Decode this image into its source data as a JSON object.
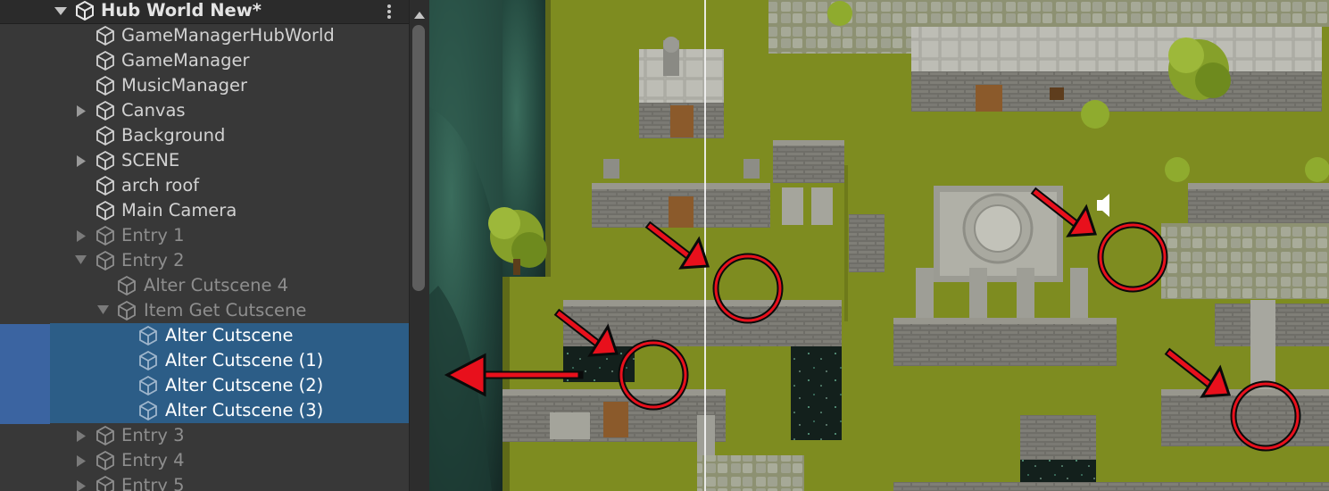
{
  "hierarchy": {
    "scene_name": "Hub World New*",
    "items": [
      {
        "label": "GameManagerHubWorld"
      },
      {
        "label": "GameManager"
      },
      {
        "label": "MusicManager"
      },
      {
        "label": "Canvas"
      },
      {
        "label": "Background"
      },
      {
        "label": "SCENE"
      },
      {
        "label": "arch roof"
      },
      {
        "label": "Main Camera"
      },
      {
        "label": "Entry 1"
      },
      {
        "label": "Entry 2"
      },
      {
        "label": "Alter Cutscene 4"
      },
      {
        "label": "Item Get Cutscene"
      },
      {
        "label": "Alter Cutscene"
      },
      {
        "label": "Alter Cutscene (1)"
      },
      {
        "label": "Alter Cutscene (2)"
      },
      {
        "label": "Alter Cutscene (3)"
      },
      {
        "label": "Entry 3"
      },
      {
        "label": "Entry 4"
      },
      {
        "label": "Entry 5"
      }
    ]
  },
  "colors": {
    "panel_bg": "#383838",
    "selection": "#2c5d87",
    "grass": "#7c8a1f",
    "annotation_red": "#e8101c"
  },
  "icons": {
    "game_object": "cube-icon",
    "expand": "triangle-right-icon",
    "collapse": "triangle-down-icon",
    "scene": "unity-logo-icon",
    "menu": "kebab-menu-icon",
    "audio": "speaker-icon"
  }
}
